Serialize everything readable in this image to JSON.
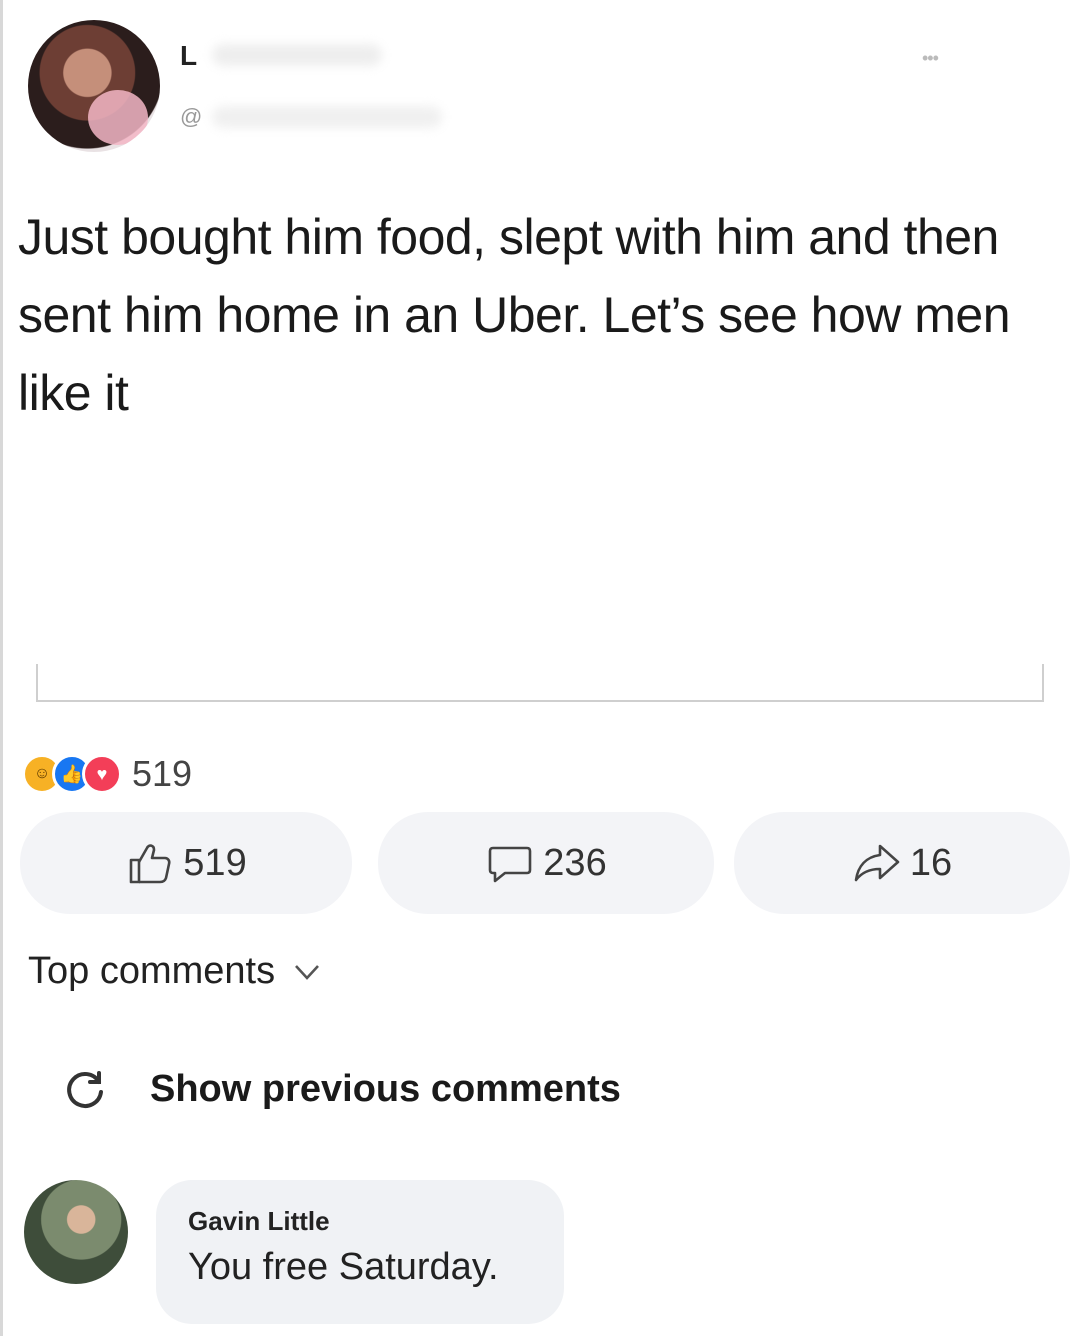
{
  "tweet": {
    "name_initial": "L",
    "handle_prefix": "@",
    "more_label": "•••",
    "text": "Just bought him food, slept with him and then sent him home in an Uber. Let’s see how men like it"
  },
  "reactions": {
    "icons": [
      "haha-icon",
      "like-icon",
      "love-icon"
    ],
    "count": "519"
  },
  "actions": {
    "like_count": "519",
    "comment_count": "236",
    "share_count": "16"
  },
  "comments": {
    "sort_label": "Top comments",
    "show_previous_label": "Show previous comments",
    "items": [
      {
        "author": "Gavin Little",
        "text": "You free Saturday."
      }
    ]
  },
  "colors": {
    "like_blue": "#1877f2",
    "love_red": "#f33e58",
    "haha_yellow": "#f7b125",
    "pill_bg": "#f3f4f7",
    "bubble_bg": "#f0f2f5"
  }
}
